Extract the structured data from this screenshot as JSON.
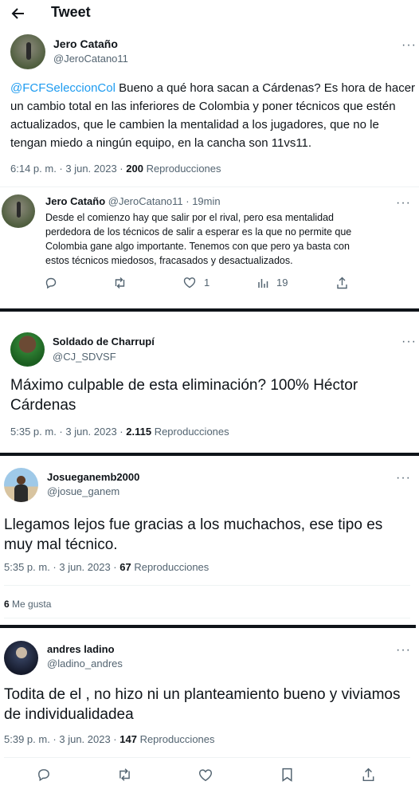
{
  "header": {
    "title": "Tweet"
  },
  "tweet1": {
    "name": "Jero Cataño",
    "handle": "@JeroCatano11",
    "mention": "@FCFSeleccionCol",
    "text": " Bueno a qué hora sacan a Cárdenas? Es hora de hacer un cambio total en las inferiores de Colombia y poner técnicos que estén actualizados, que le cambien la mentalidad a los jugadores, que no le tengan miedo a ningún equipo, en la cancha son 11vs11.",
    "time": "6:14 p. m. · 3 jun. 2023 · ",
    "views": "200",
    "views_label": " Reproducciones"
  },
  "reply1": {
    "name": "Jero Cataño",
    "meta": " @JeroCatano11 · 19min",
    "text": "Desde el comienzo hay que salir por el rival, pero esa mentalidad perdedora de los técnicos de salir a esperar es la que no permite que Colombia gane algo importante. Tenemos con que pero ya basta con estos técnicos miedosos, fracasados y desactualizados.",
    "likes": "1",
    "views": "19"
  },
  "tweet2": {
    "name": "Soldado de Charrupí",
    "handle": "@CJ_SDVSF",
    "text": "Máximo culpable de esta eliminación? 100% Héctor Cárdenas",
    "time": "5:35 p. m. · 3 jun. 2023 · ",
    "views": "2.115",
    "views_label": " Reproducciones"
  },
  "tweet3": {
    "name": "Josueganemb2000",
    "handle": "@josue_ganem",
    "text": "Llegamos lejos fue gracias a los muchachos, ese tipo es muy mal técnico.",
    "time": "5:35 p. m. · 3 jun. 2023 · ",
    "views": "67",
    "views_label": " Reproducciones",
    "likes": "6",
    "likes_label": " Me gusta"
  },
  "tweet4": {
    "name": "andres ladino",
    "handle": "@ladino_andres",
    "text": "Todita de el , no hizo ni un planteamiento bueno y viviamos de individualidadea",
    "time": "5:39 p. m. · 3 jun. 2023 · ",
    "views": "147",
    "views_label": " Reproducciones"
  },
  "icons": [
    "back-arrow-icon",
    "more-icon",
    "reply-icon",
    "retweet-icon",
    "like-icon",
    "views-icon",
    "share-icon",
    "bookmark-icon"
  ],
  "colors": {
    "link": "#1d9bf0",
    "muted": "#536471",
    "text": "#0f1419"
  }
}
